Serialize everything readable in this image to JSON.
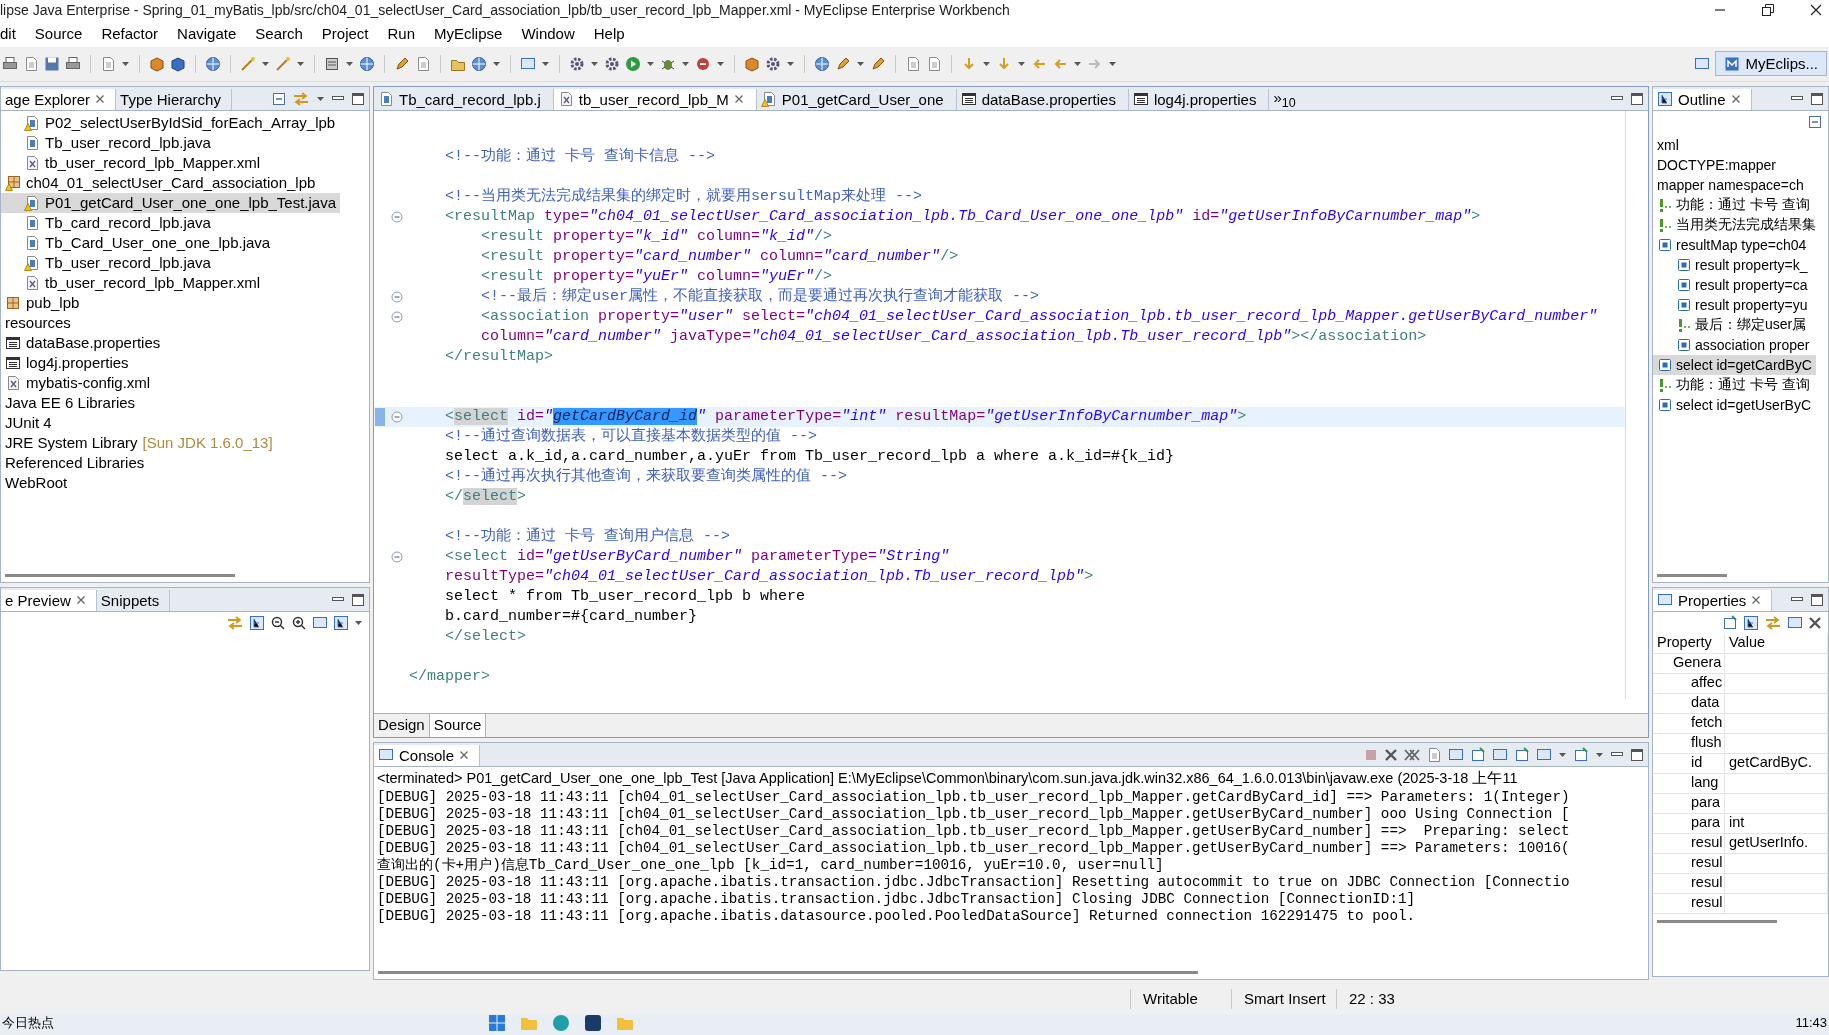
{
  "window": {
    "title": "lipse Java Enterprise - Spring_01_myBatis_lpb/src/ch04_01_selectUser_Card_association_lpb/tb_user_record_lpb_Mapper.xml - MyEclipse Enterprise Workbench"
  },
  "menu": [
    "dit",
    "Source",
    "Refactor",
    "Navigate",
    "Search",
    "Project",
    "Run",
    "MyEclipse",
    "Window",
    "Help"
  ],
  "perspective": {
    "label": "MyEclips...",
    "selected": true
  },
  "explorer": {
    "tabs": [
      {
        "label": "age Explorer",
        "selected": true
      },
      {
        "label": "Type Hierarchy",
        "selected": false
      }
    ],
    "continued_children": [
      {
        "label": "P02_selectUserByIdSid_forEach_Array_lpb",
        "kind": "java-warning",
        "selected": false
      },
      {
        "label": "Tb_user_record_lpb.java",
        "kind": "java",
        "selected": false
      },
      {
        "label": "tb_user_record_lpb_Mapper.xml",
        "kind": "xml",
        "selected": false
      }
    ],
    "items": [
      {
        "label": "ch04_01_selectUser_Card_association_lpb",
        "kind": "package-warning",
        "selected": false,
        "children": [
          {
            "label": "P01_getCard_User_one_one_lpb_Test.java",
            "kind": "java-warning",
            "selected": true
          },
          {
            "label": "Tb_card_record_lpb.java",
            "kind": "java",
            "selected": false
          },
          {
            "label": "Tb_Card_User_one_one_lpb.java",
            "kind": "java",
            "selected": false
          },
          {
            "label": "Tb_user_record_lpb.java",
            "kind": "java-warning",
            "selected": false
          },
          {
            "label": "tb_user_record_lpb_Mapper.xml",
            "kind": "xml",
            "selected": false
          }
        ]
      },
      {
        "label": "pub_lpb",
        "kind": "package",
        "selected": false
      },
      {
        "label": "resources",
        "kind": "plain",
        "selected": false
      },
      {
        "label": "dataBase.properties",
        "kind": "props",
        "selected": false
      },
      {
        "label": "log4j.properties",
        "kind": "props",
        "selected": false
      },
      {
        "label": "mybatis-config.xml",
        "kind": "xml",
        "selected": false
      },
      {
        "label": "Java EE 6 Libraries",
        "kind": "plain",
        "selected": false
      },
      {
        "label": "JUnit 4",
        "kind": "plain",
        "selected": false
      },
      {
        "label": "JRE System Library",
        "kind": "plain",
        "selected": false,
        "decoration": "[Sun JDK 1.6.0_13]"
      },
      {
        "label": "Referenced Libraries",
        "kind": "plain",
        "selected": false
      },
      {
        "label": "WebRoot",
        "kind": "plain",
        "selected": false
      }
    ]
  },
  "preview": {
    "tabs": [
      {
        "label": "e Preview",
        "selected": true
      },
      {
        "label": "Snippets",
        "selected": false
      }
    ]
  },
  "editor": {
    "tabs": [
      {
        "label": "Tb_card_record_lpb.j",
        "kind": "java",
        "selected": false
      },
      {
        "label": "tb_user_record_lpb_M",
        "kind": "xml",
        "selected": true
      },
      {
        "label": "P01_getCard_User_one",
        "kind": "java-warning",
        "selected": false
      },
      {
        "label": "dataBase.properties",
        "kind": "props",
        "selected": false
      },
      {
        "label": "log4j.properties",
        "kind": "props",
        "selected": false
      }
    ],
    "overflow": "»$_{10}$",
    "lines": [
      {
        "fold": false,
        "current": false
      },
      {
        "fold": false,
        "current": false,
        "tokens": [
          {
            "kind": "comment",
            "text": "    <!--功能：通过 卡号 查询卡信息 -->"
          }
        ]
      },
      {
        "fold": false,
        "current": false
      },
      {
        "fold": false,
        "current": false,
        "tokens": [
          {
            "kind": "comment",
            "text": "    <!--当用类无法完成结果集的绑定时，就要用sersultMap来处理 -->"
          }
        ]
      },
      {
        "fold": true,
        "current": false,
        "tokens": [
          {
            "kind": "tag",
            "text": "    <resultMap"
          },
          {
            "kind": "attr",
            "text": " type="
          },
          {
            "kind": "value",
            "text": "\"ch04_01_selectUser_Card_association_lpb.Tb_Card_User_one_one_lpb\""
          },
          {
            "kind": "attr",
            "text": " id="
          },
          {
            "kind": "value",
            "text": "\"getUserInfoByCarnumber_map\""
          },
          {
            "kind": "tag",
            "text": ">"
          }
        ]
      },
      {
        "fold": false,
        "current": false,
        "tokens": [
          {
            "kind": "tag",
            "text": "        <result"
          },
          {
            "kind": "attr",
            "text": " property="
          },
          {
            "kind": "value",
            "text": "\"k_id\""
          },
          {
            "kind": "attr",
            "text": " column="
          },
          {
            "kind": "value",
            "text": "\"k_id\""
          },
          {
            "kind": "tag",
            "text": "/>"
          }
        ]
      },
      {
        "fold": false,
        "current": false,
        "tokens": [
          {
            "kind": "tag",
            "text": "        <result"
          },
          {
            "kind": "attr",
            "text": " property="
          },
          {
            "kind": "value",
            "text": "\"card_number\""
          },
          {
            "kind": "attr",
            "text": " column="
          },
          {
            "kind": "value",
            "text": "\"card_number\""
          },
          {
            "kind": "tag",
            "text": "/>"
          }
        ]
      },
      {
        "fold": false,
        "current": false,
        "tokens": [
          {
            "kind": "tag",
            "text": "        <result"
          },
          {
            "kind": "attr",
            "text": " property="
          },
          {
            "kind": "value",
            "text": "\"yuEr\""
          },
          {
            "kind": "attr",
            "text": " column="
          },
          {
            "kind": "value",
            "text": "\"yuEr\""
          },
          {
            "kind": "tag",
            "text": "/>"
          }
        ]
      },
      {
        "fold": true,
        "current": false,
        "tokens": [
          {
            "kind": "comment",
            "text": "        <!--最后：绑定user属性，不能直接获取，而是要通过再次执行查询才能获取 -->"
          }
        ]
      },
      {
        "fold": true,
        "current": false,
        "tokens": [
          {
            "kind": "tag",
            "text": "        <association"
          },
          {
            "kind": "attr",
            "text": " property="
          },
          {
            "kind": "value",
            "text": "\"user\""
          },
          {
            "kind": "attr",
            "text": " select="
          },
          {
            "kind": "value",
            "text": "\"ch04_01_selectUser_Card_association_lpb.tb_user_record_lpb_Mapper.getUserByCard_number\""
          }
        ]
      },
      {
        "fold": false,
        "current": false,
        "tokens": [
          {
            "kind": "attr",
            "text": "        column="
          },
          {
            "kind": "value",
            "text": "\"card_number\""
          },
          {
            "kind": "attr",
            "text": " javaType="
          },
          {
            "kind": "value",
            "text": "\"ch04_01_selectUser_Card_association_lpb.Tb_user_record_lpb\""
          },
          {
            "kind": "tag",
            "text": "></association>"
          }
        ]
      },
      {
        "fold": false,
        "current": false,
        "tokens": [
          {
            "kind": "tag",
            "text": "    </resultMap>"
          }
        ]
      },
      {
        "fold": false,
        "current": false
      },
      {
        "fold": false,
        "current": false
      },
      {
        "fold": true,
        "current": true,
        "tokens": [
          {
            "kind": "tag",
            "text": "    <"
          },
          {
            "kind": "match",
            "text": "select"
          },
          {
            "kind": "attr",
            "text": " id="
          },
          {
            "kind": "value",
            "text": "\""
          },
          {
            "kind": "sel",
            "text": "getCardByCard_id"
          },
          {
            "kind": "value",
            "text": "\""
          },
          {
            "kind": "attr",
            "text": " parameterType="
          },
          {
            "kind": "value",
            "text": "\"int\""
          },
          {
            "kind": "attr",
            "text": " resultMap="
          },
          {
            "kind": "value",
            "text": "\"getUserInfoByCarnumber_map\""
          },
          {
            "kind": "tag",
            "text": ">"
          }
        ]
      },
      {
        "fold": false,
        "current": false,
        "tokens": [
          {
            "kind": "comment",
            "text": "    <!--通过查询数据表，可以直接基本数据类型的值 -->"
          }
        ]
      },
      {
        "fold": false,
        "current": false,
        "tokens": [
          {
            "kind": "text",
            "text": "    select a.k_id,a.card_number,a.yuEr from Tb_user_record_lpb a where a.k_id=#{k_id}"
          }
        ]
      },
      {
        "fold": false,
        "current": false,
        "tokens": [
          {
            "kind": "comment",
            "text": "    <!--通过再次执行其他查询，来获取要查询类属性的值 -->"
          }
        ]
      },
      {
        "fold": false,
        "current": false,
        "tokens": [
          {
            "kind": "tag",
            "text": "    </"
          },
          {
            "kind": "match",
            "text": "select"
          },
          {
            "kind": "tag",
            "text": ">"
          }
        ]
      },
      {
        "fold": false,
        "current": false
      },
      {
        "fold": false,
        "current": false,
        "tokens": [
          {
            "kind": "comment",
            "text": "    <!--功能：通过 卡号 查询用户信息 -->"
          }
        ]
      },
      {
        "fold": true,
        "current": false,
        "tokens": [
          {
            "kind": "tag",
            "text": "    <select"
          },
          {
            "kind": "attr",
            "text": " id="
          },
          {
            "kind": "value",
            "text": "\"getUserByCard_number\""
          },
          {
            "kind": "attr",
            "text": " parameterType="
          },
          {
            "kind": "value",
            "text": "\"String\""
          }
        ]
      },
      {
        "fold": false,
        "current": false,
        "tokens": [
          {
            "kind": "attr",
            "text": "    resultType="
          },
          {
            "kind": "value",
            "text": "\"ch04_01_selectUser_Card_association_lpb.Tb_user_record_lpb\""
          },
          {
            "kind": "tag",
            "text": ">"
          }
        ]
      },
      {
        "fold": false,
        "current": false,
        "tokens": [
          {
            "kind": "text",
            "text": "    select * from Tb_user_record_lpb b where"
          }
        ]
      },
      {
        "fold": false,
        "current": false,
        "tokens": [
          {
            "kind": "text",
            "text": "    b.card_number=#{card_number}"
          }
        ]
      },
      {
        "fold": false,
        "current": false,
        "tokens": [
          {
            "kind": "tag",
            "text": "    </select>"
          }
        ]
      },
      {
        "fold": false,
        "current": false
      },
      {
        "fold": false,
        "current": false,
        "tokens": [
          {
            "kind": "tag",
            "text": "</mapper>"
          }
        ]
      }
    ],
    "bottom_tabs": [
      {
        "label": "Design",
        "selected": false
      },
      {
        "label": "Source",
        "selected": true
      }
    ]
  },
  "console": {
    "tab": {
      "label": "Console",
      "selected": true
    },
    "header": "<terminated> P01_getCard_User_one_one_lpb_Test [Java Application] E:\\MyEclipse\\Common\\binary\\com.sun.java.jdk.win32.x86_64_1.6.0.013\\bin\\javaw.exe (2025-3-18 上午11",
    "lines": [
      "[DEBUG] 2025-03-18 11:43:11 [ch04_01_selectUser_Card_association_lpb.tb_user_record_lpb_Mapper.getCardByCard_id] ==> Parameters: 1(Integer)",
      "[DEBUG] 2025-03-18 11:43:11 [ch04_01_selectUser_Card_association_lpb.tb_user_record_lpb_Mapper.getUserByCard_number] ooo Using Connection [",
      "[DEBUG] 2025-03-18 11:43:11 [ch04_01_selectUser_Card_association_lpb.tb_user_record_lpb_Mapper.getUserByCard_number] ==>  Preparing: select",
      "[DEBUG] 2025-03-18 11:43:11 [ch04_01_selectUser_Card_association_lpb.tb_user_record_lpb_Mapper.getUserByCard_number] ==> Parameters: 10016(",
      "查询出的(卡+用户)信息Tb_Card_User_one_one_lpb [k_id=1, card_number=10016, yuEr=10.0, user=null]",
      "[DEBUG] 2025-03-18 11:43:11 [org.apache.ibatis.transaction.jdbc.JdbcTransaction] Resetting autocommit to true on JDBC Connection [Connectio",
      "[DEBUG] 2025-03-18 11:43:11 [org.apache.ibatis.transaction.jdbc.JdbcTransaction] Closing JDBC Connection [ConnectionID:1]",
      "[DEBUG] 2025-03-18 11:43:11 [org.apache.ibatis.datasource.pooled.PooledDataSource] Returned connection 162291475 to pool."
    ]
  },
  "outline": {
    "tab": {
      "label": "Outline",
      "selected": true
    },
    "items": [
      {
        "label": "xml",
        "kind": "plain",
        "selected": false
      },
      {
        "label": "DOCTYPE:mapper",
        "kind": "plain",
        "selected": false
      },
      {
        "label": "mapper namespace=ch",
        "kind": "plain",
        "selected": false
      },
      {
        "label": "功能：通过 卡号 查询",
        "kind": "comment",
        "selected": false
      },
      {
        "label": "当用类无法完成结果集",
        "kind": "comment",
        "selected": false
      },
      {
        "label": "resultMap type=ch04",
        "kind": "element",
        "selected": false,
        "children": [
          {
            "label": "result property=k_",
            "kind": "element",
            "selected": false
          },
          {
            "label": "result property=ca",
            "kind": "element",
            "selected": false
          },
          {
            "label": "result property=yu",
            "kind": "element",
            "selected": false
          },
          {
            "label": "最后：绑定user属",
            "kind": "comment",
            "selected": false
          },
          {
            "label": "association proper",
            "kind": "element",
            "selected": false
          }
        ]
      },
      {
        "label": "select id=getCardByC",
        "kind": "element",
        "selected": true
      },
      {
        "label": "功能：通过 卡号 查询",
        "kind": "comment",
        "selected": false
      },
      {
        "label": "select id=getUserByC",
        "kind": "element",
        "selected": false
      }
    ]
  },
  "properties": {
    "tab": {
      "label": "Properties",
      "selected": true
    },
    "columns": [
      "Property",
      "Value"
    ],
    "category": "Genera",
    "rows": [
      {
        "property": "affec"
      },
      {
        "property": "data"
      },
      {
        "property": "fetch"
      },
      {
        "property": "flush"
      },
      {
        "property": "id",
        "value": "getCardByC."
      },
      {
        "property": "lang"
      },
      {
        "property": "para"
      },
      {
        "property": "para",
        "value": "int"
      },
      {
        "property": "resul",
        "value": "getUserInfo."
      },
      {
        "property": "resul"
      },
      {
        "property": "resul"
      },
      {
        "property": "resul"
      }
    ]
  },
  "status_bar": [
    "Writable",
    "Smart Insert",
    "22 : 33"
  ],
  "taskbar": {
    "news": "今日热点",
    "clock": "11:43"
  }
}
